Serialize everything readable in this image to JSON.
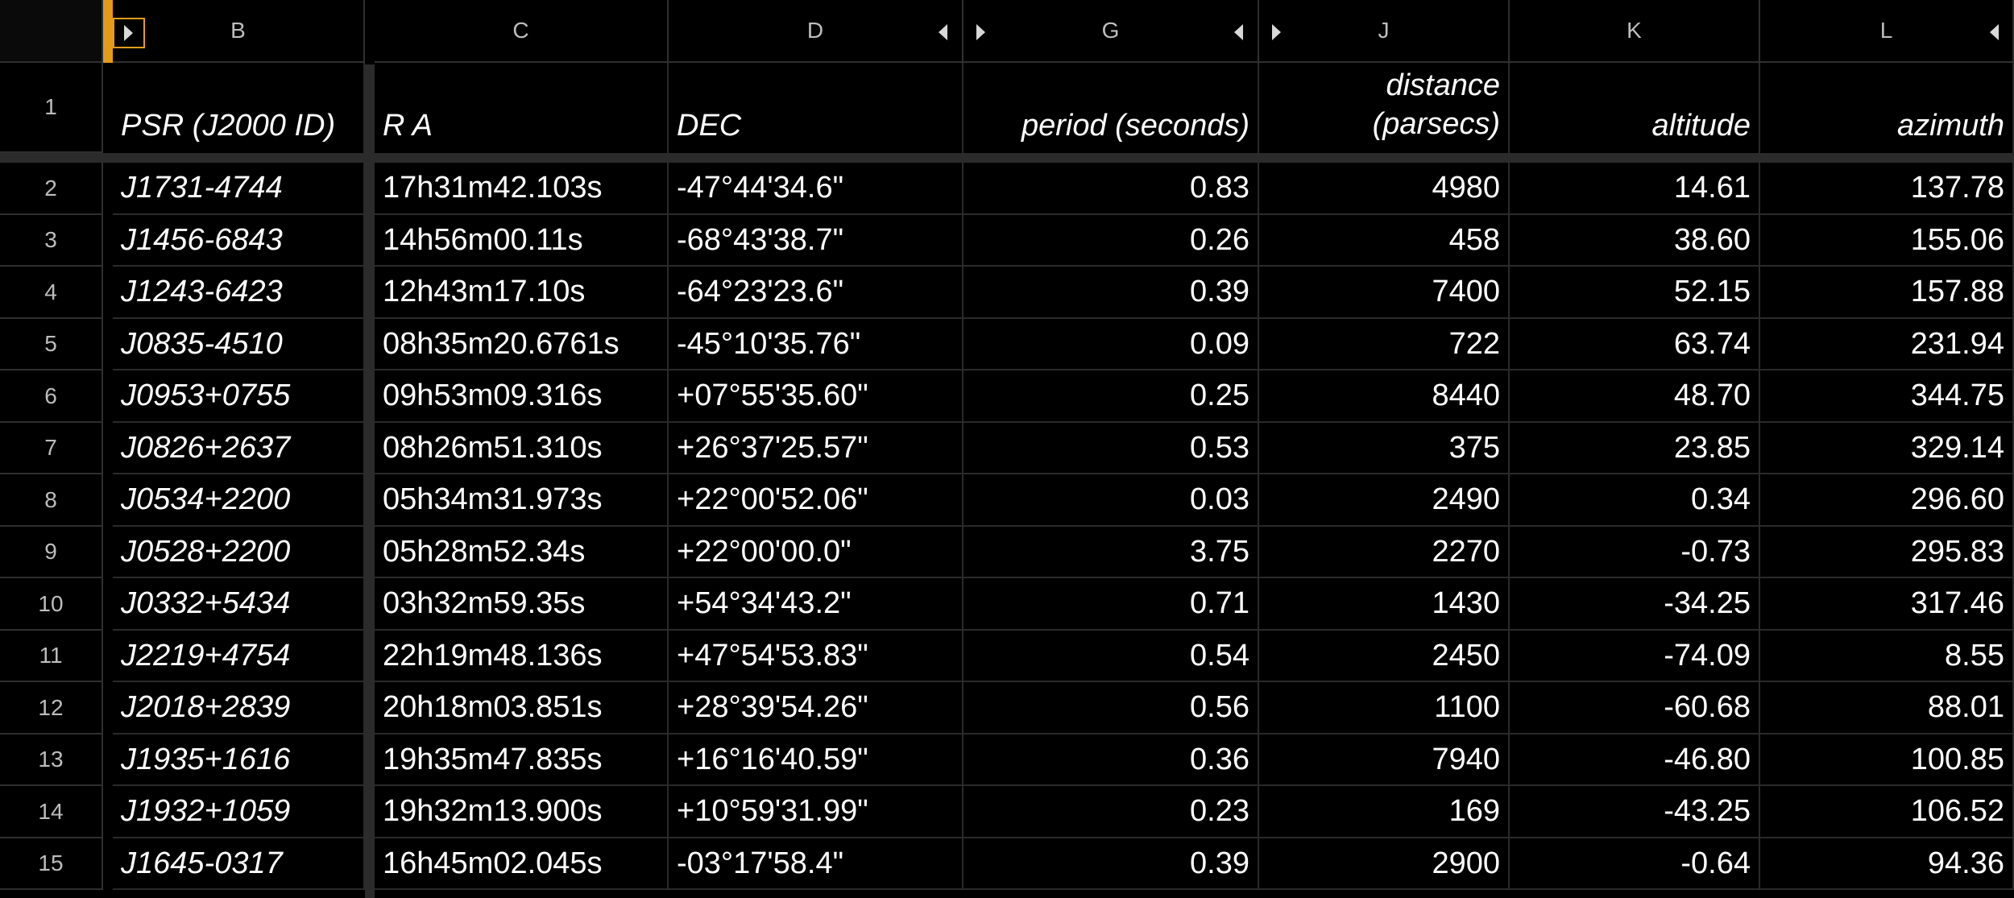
{
  "columns": [
    {
      "letter": "B"
    },
    {
      "letter": "C"
    },
    {
      "letter": "D"
    },
    {
      "letter": "G"
    },
    {
      "letter": "J"
    },
    {
      "letter": "K"
    },
    {
      "letter": "L"
    }
  ],
  "header_row": {
    "number": "1",
    "labels": [
      "PSR (J2000 ID)",
      "R A",
      "DEC",
      "period (seconds)",
      "distance",
      "(parsecs)",
      "altitude",
      "azimuth"
    ]
  },
  "rows": [
    {
      "n": "2",
      "cells": [
        "J1731-4744",
        "17h31m42.103s",
        "-47°44'34.6\"",
        "0.83",
        "4980",
        "14.61",
        "137.78"
      ]
    },
    {
      "n": "3",
      "cells": [
        "J1456-6843",
        "14h56m00.11s",
        "-68°43'38.7\"",
        "0.26",
        "458",
        "38.60",
        "155.06"
      ]
    },
    {
      "n": "4",
      "cells": [
        "J1243-6423",
        "12h43m17.10s",
        "-64°23'23.6\"",
        "0.39",
        "7400",
        "52.15",
        "157.88"
      ]
    },
    {
      "n": "5",
      "cells": [
        "J0835-4510",
        "08h35m20.6761s",
        "-45°10'35.76\"",
        "0.09",
        "722",
        "63.74",
        "231.94"
      ]
    },
    {
      "n": "6",
      "cells": [
        "J0953+0755",
        "09h53m09.316s",
        "+07°55'35.60\"",
        "0.25",
        "8440",
        "48.70",
        "344.75"
      ]
    },
    {
      "n": "7",
      "cells": [
        "J0826+2637",
        "08h26m51.310s",
        "+26°37'25.57\"",
        "0.53",
        "375",
        "23.85",
        "329.14"
      ]
    },
    {
      "n": "8",
      "cells": [
        "J0534+2200",
        "05h34m31.973s",
        "+22°00'52.06\"",
        "0.03",
        "2490",
        "0.34",
        "296.60"
      ]
    },
    {
      "n": "9",
      "cells": [
        "J0528+2200",
        "05h28m52.34s",
        "+22°00'00.0\"",
        "3.75",
        "2270",
        "-0.73",
        "295.83"
      ]
    },
    {
      "n": "10",
      "cells": [
        "J0332+5434",
        "03h32m59.35s",
        "+54°34'43.2\"",
        "0.71",
        "1430",
        "-34.25",
        "317.46"
      ]
    },
    {
      "n": "11",
      "cells": [
        "J2219+4754",
        "22h19m48.136s",
        "+47°54'53.83\"",
        "0.54",
        "2450",
        "-74.09",
        "8.55"
      ]
    },
    {
      "n": "12",
      "cells": [
        "J2018+2839",
        "20h18m03.851s",
        "+28°39'54.26\"",
        "0.56",
        "1100",
        "-60.68",
        "88.01"
      ]
    },
    {
      "n": "13",
      "cells": [
        "J1935+1616",
        "19h35m47.835s",
        "+16°16'40.59\"",
        "0.36",
        "7940",
        "-46.80",
        "100.85"
      ]
    },
    {
      "n": "14",
      "cells": [
        "J1932+1059",
        "19h32m13.900s",
        "+10°59'31.99\"",
        "0.23",
        "169",
        "-43.25",
        "106.52"
      ]
    },
    {
      "n": "15",
      "cells": [
        "J1645-0317",
        "16h45m02.045s",
        "-03°17'58.4\"",
        "0.39",
        "2900",
        "-0.64",
        "94.36"
      ]
    }
  ],
  "colors": {
    "background": "#000000",
    "gridline": "#2a2a2a",
    "header_text": "#bdbdbd",
    "cell_text": "#ffffff",
    "accent": "#e39b1b"
  },
  "icons": [
    "expand-hidden-columns-right-icon",
    "expand-hidden-columns-left-icon"
  ]
}
